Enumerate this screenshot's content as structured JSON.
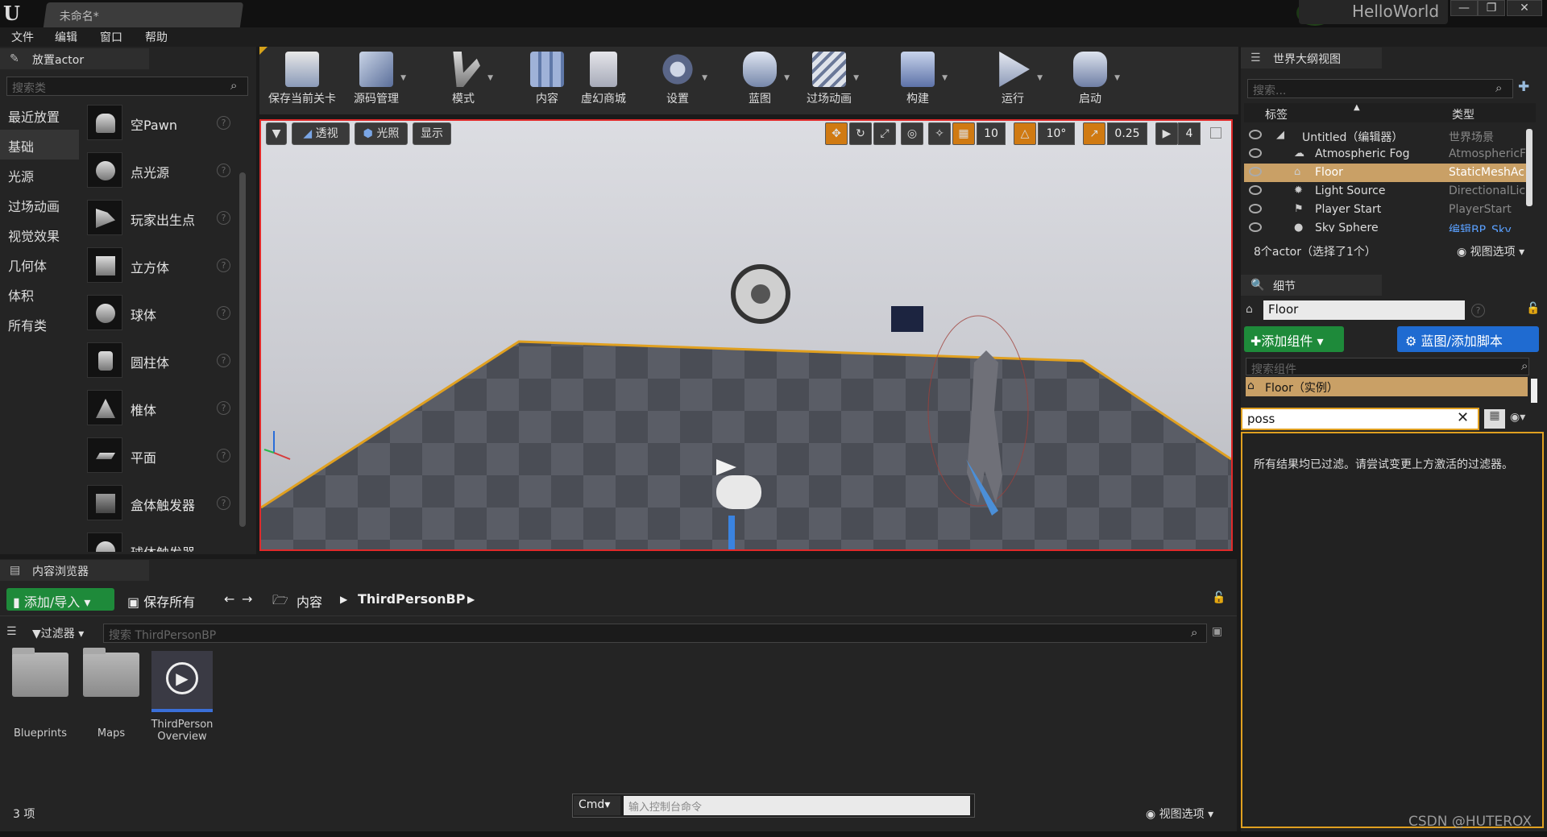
{
  "window": {
    "tab_title": "未命名*",
    "project_name": "HelloWorld",
    "controls": [
      "—",
      "❐",
      "✕"
    ]
  },
  "menu": [
    "文件",
    "编辑",
    "窗口",
    "帮助"
  ],
  "place_actors": {
    "tab": "放置actor",
    "search_placeholder": "搜索类",
    "categories": [
      "最近放置",
      "基础",
      "光源",
      "过场动画",
      "视觉效果",
      "几何体",
      "体积",
      "所有类"
    ],
    "selected_category": "基础",
    "items": [
      "空Pawn",
      "点光源",
      "玩家出生点",
      "立方体",
      "球体",
      "圆柱体",
      "椎体",
      "平面",
      "盒体触发器",
      "球体触发器"
    ]
  },
  "toolbar": {
    "buttons": [
      "保存当前关卡",
      "源码管理",
      "模式",
      "内容",
      "虚幻商城",
      "设置",
      "蓝图",
      "过场动画",
      "构建",
      "运行",
      "启动"
    ]
  },
  "viewport": {
    "buttons": [
      "透视",
      "光照",
      "显示"
    ],
    "grid_snap": "10",
    "rotation_snap": "10°",
    "scale_snap": "0.25",
    "camera_speed": "4"
  },
  "outliner": {
    "tab": "世界大纲视图",
    "search_placeholder": "搜索...",
    "col_label": "标签",
    "col_type": "类型",
    "rows": [
      {
        "name": "Untitled（编辑器）",
        "type": "世界场景"
      },
      {
        "name": "Atmospheric Fog",
        "type": "AtmosphericF"
      },
      {
        "name": "Floor",
        "type": "StaticMeshAc"
      },
      {
        "name": "Light Source",
        "type": "DirectionalLic"
      },
      {
        "name": "Player Start",
        "type": "PlayerStart"
      },
      {
        "name": "Sky Sphere",
        "type": "编辑BP_Sky"
      }
    ],
    "selected": "Floor",
    "footer": "8个actor（选择了1个）",
    "view_options": "视图选项"
  },
  "details": {
    "tab": "细节",
    "name_value": "Floor",
    "add_component": "添加组件",
    "blueprint_script": "蓝图/添加脚本",
    "search_components_placeholder": "搜索组件",
    "component": "Floor（实例）",
    "filter_value": "poss",
    "filtered_message": "所有结果均已过滤。请尝试变更上方激活的过滤器。"
  },
  "content_browser": {
    "tab": "内容浏览器",
    "add_import": "添加/导入",
    "save_all": "保存所有",
    "path": [
      "内容",
      "ThirdPersonBP"
    ],
    "filter": "过滤器",
    "search_placeholder": "搜索 ThirdPersonBP",
    "assets": [
      "Blueprints",
      "Maps",
      "ThirdPerson\nOverview"
    ],
    "count": "3 项",
    "view_options": "视图选项"
  },
  "console": {
    "cmd_label": "Cmd",
    "placeholder": "输入控制台命令"
  },
  "watermark": "CSDN @HUTEROX"
}
